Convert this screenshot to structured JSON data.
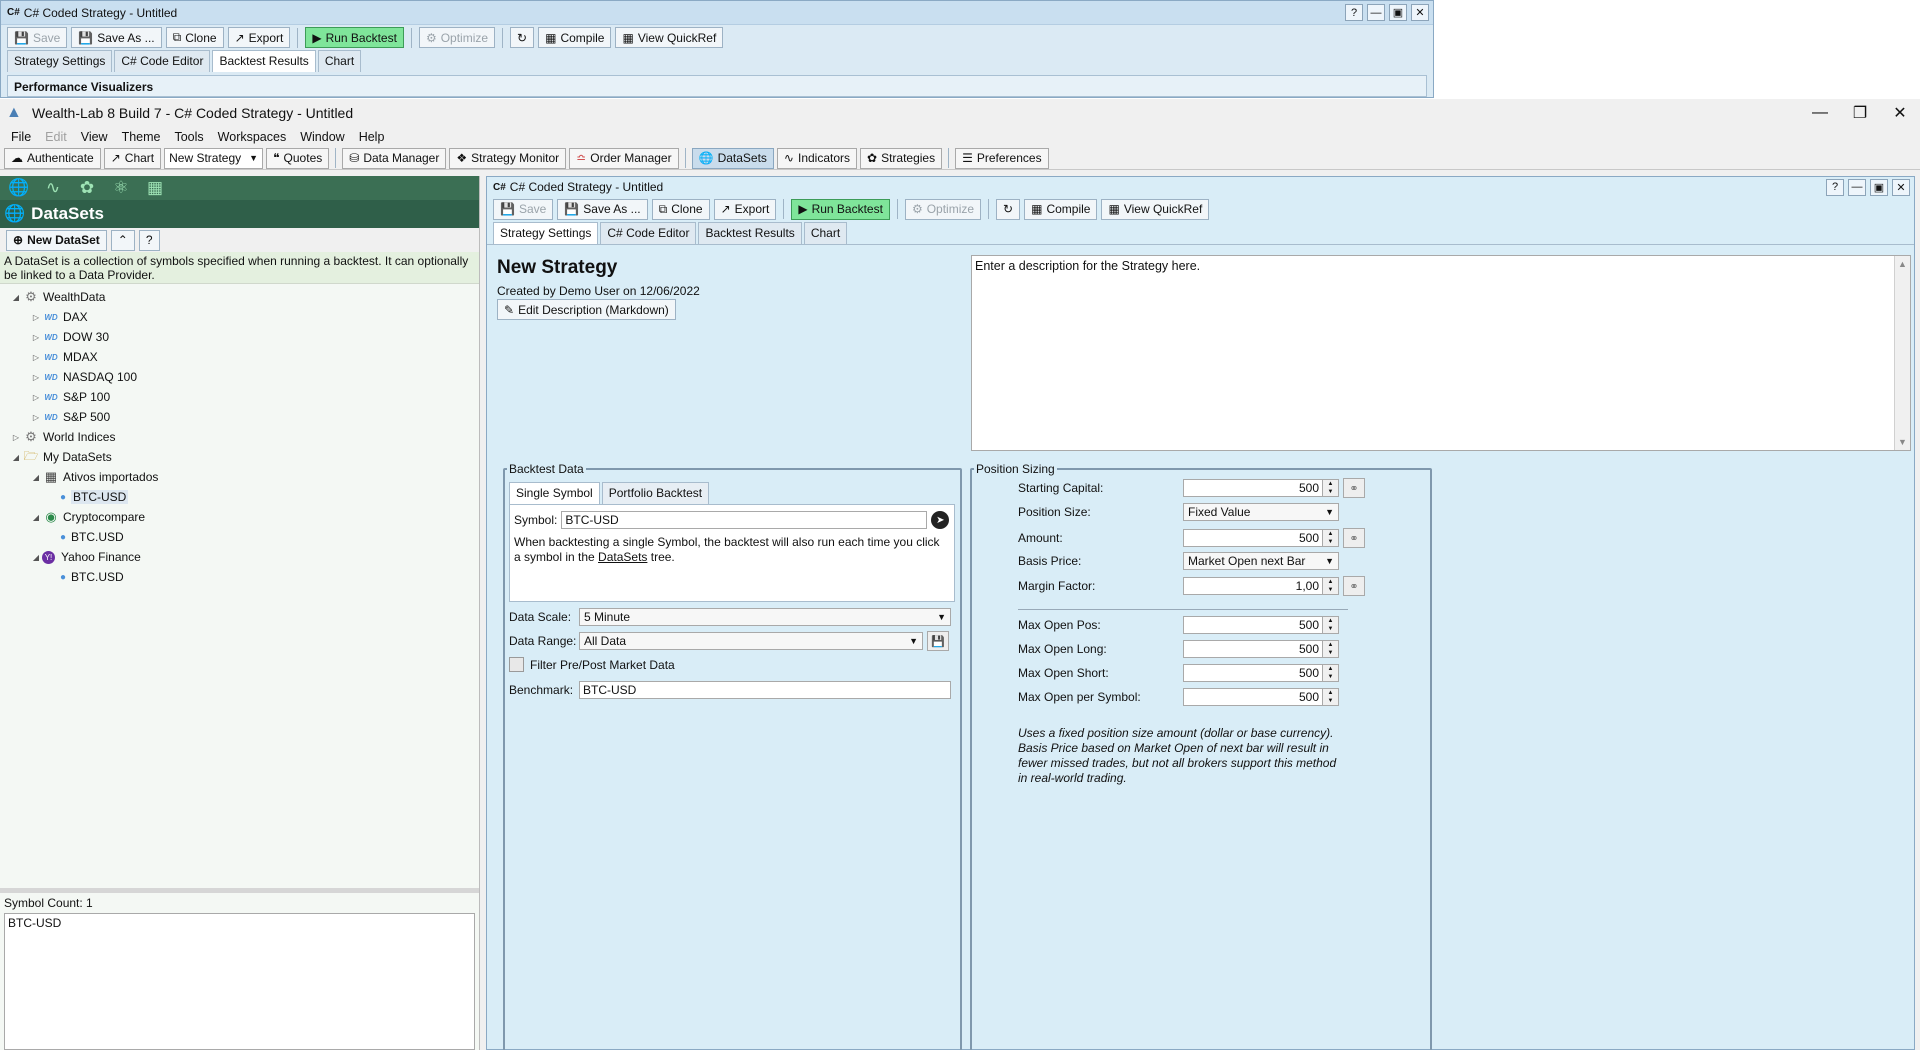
{
  "bgwin": {
    "title": "C# Coded Strategy - Untitled",
    "toolbar": {
      "save": "Save",
      "save_as": "Save As ...",
      "clone": "Clone",
      "export": "Export",
      "run_backtest": "Run Backtest",
      "optimize": "Optimize",
      "compile": "Compile",
      "view_quickref": "View QuickRef"
    },
    "tabs": [
      "Strategy Settings",
      "C# Code Editor",
      "Backtest Results",
      "Chart"
    ],
    "active_tab": "Backtest Results",
    "section": "Performance Visualizers"
  },
  "app": {
    "title": "Wealth-Lab 8 Build 7 - C# Coded Strategy - Untitled",
    "menu": [
      "File",
      "Edit",
      "View",
      "Theme",
      "Tools",
      "Workspaces",
      "Window",
      "Help"
    ],
    "toolbar": {
      "authenticate": "Authenticate",
      "chart": "Chart",
      "strategy_select": "New Strategy",
      "quotes": "Quotes",
      "data_manager": "Data Manager",
      "strategy_monitor": "Strategy Monitor",
      "order_manager": "Order Manager",
      "datasets": "DataSets",
      "indicators": "Indicators",
      "strategies": "Strategies",
      "preferences": "Preferences"
    }
  },
  "left": {
    "header": "DataSets",
    "new_dataset": "New DataSet",
    "description": "A DataSet is a collection of symbols specified when running a backtest. It can optionally be linked to a Data Provider.",
    "tree": {
      "wealthdata": "WealthData",
      "wealthdata_items": [
        "DAX",
        "DOW 30",
        "MDAX",
        "NASDAQ 100",
        "S&P 100",
        "S&P 500"
      ],
      "world_indices": "World Indices",
      "my_datasets": "My DataSets",
      "ativos": "Ativos importados",
      "ativos_sym": "BTC-USD",
      "cryptocompare": "Cryptocompare",
      "cryptocompare_sym": "BTC.USD",
      "yahoo": "Yahoo Finance",
      "yahoo_sym": "BTC.USD"
    },
    "symbol_count": "Symbol Count: 1",
    "symbols": "BTC-USD"
  },
  "child": {
    "title": "C# Coded Strategy - Untitled",
    "tabs": [
      "Strategy Settings",
      "C# Code Editor",
      "Backtest Results",
      "Chart"
    ],
    "active_tab": "Strategy Settings",
    "strategy_name": "New Strategy",
    "created_by": "Created by Demo User on 12/06/2022",
    "edit_description": "Edit Description (Markdown)",
    "description_placeholder": "Enter a description for the Strategy here.",
    "backtest_data": {
      "legend": "Backtest Data",
      "tab_single": "Single Symbol",
      "tab_portfolio": "Portfolio Backtest",
      "symbol_label": "Symbol:",
      "symbol_value": "BTC-USD",
      "help_prefix": "When backtesting a single Symbol, the backtest will also run each time you click a symbol in the ",
      "help_link": "DataSets",
      "help_suffix": " tree.",
      "data_scale_label": "Data Scale:",
      "data_scale_value": "5 Minute",
      "data_range_label": "Data Range:",
      "data_range_value": "All Data",
      "filter_label": "Filter Pre/Post Market Data",
      "filter_checked": false,
      "benchmark_label": "Benchmark:",
      "benchmark_value": "BTC-USD"
    },
    "position_sizing": {
      "legend": "Position Sizing",
      "starting_capital_label": "Starting Capital:",
      "starting_capital": "500",
      "position_size_label": "Position Size:",
      "position_size": "Fixed Value",
      "amount_label": "Amount:",
      "amount": "500",
      "basis_price_label": "Basis Price:",
      "basis_price": "Market Open next Bar",
      "margin_factor_label": "Margin Factor:",
      "margin_factor": "1,00",
      "max_open_pos_label": "Max Open Pos:",
      "max_open_pos": "500",
      "max_open_long_label": "Max Open Long:",
      "max_open_long": "500",
      "max_open_short_label": "Max Open Short:",
      "max_open_short": "500",
      "max_open_per_symbol_label": "Max Open per Symbol:",
      "max_open_per_symbol": "500",
      "note": "Uses a fixed position size amount (dollar or base currency). Basis Price based on Market Open of next bar will result in fewer missed trades, but not all brokers support this method in real-world trading."
    }
  },
  "colors": {
    "run_backtest": "#7fe59a",
    "left_header": "#2f5f49",
    "panel_bg": "#d9edf7"
  }
}
